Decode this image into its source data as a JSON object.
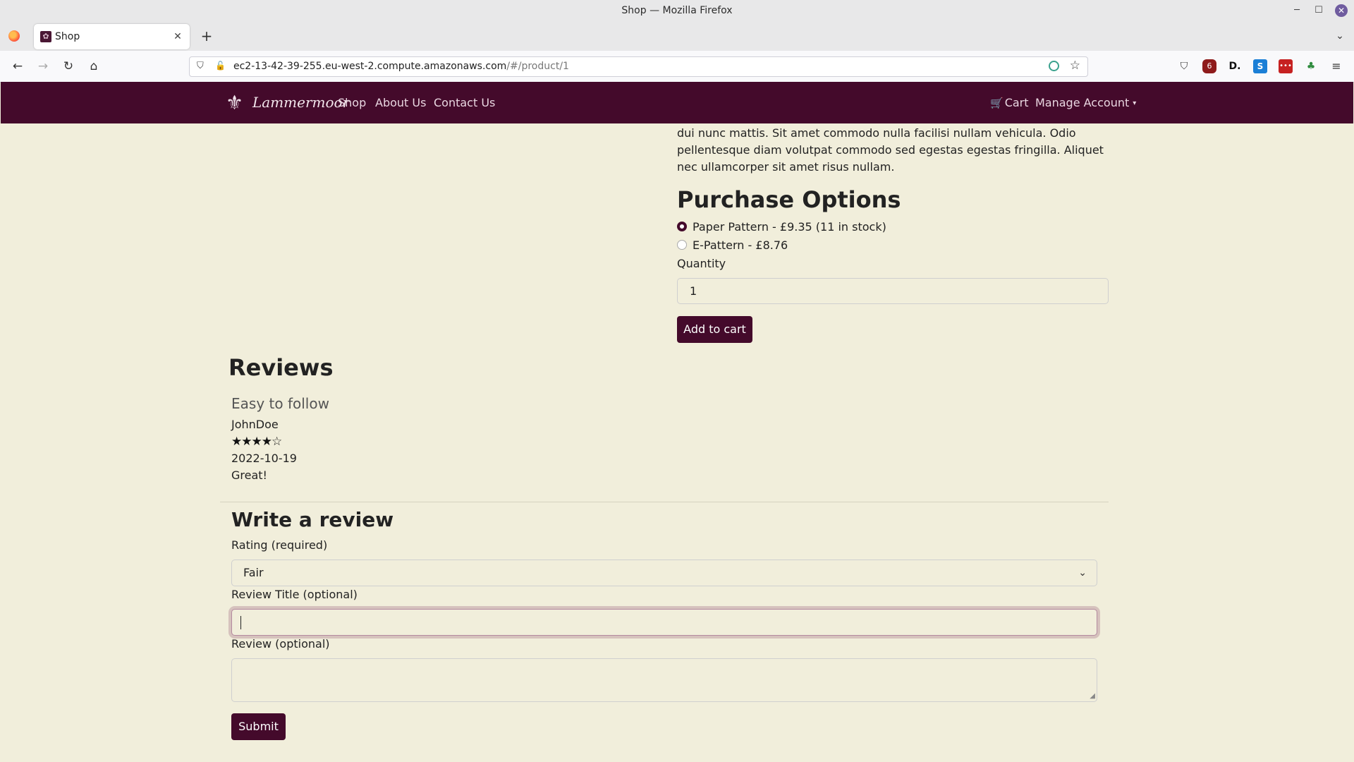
{
  "window": {
    "title": "Shop — Mozilla Firefox",
    "minimize_glyph": "─",
    "maximize_glyph": "☐",
    "close_glyph": "✕"
  },
  "tabbar": {
    "tab_title": "Shop",
    "favicon_glyph": "✿",
    "tab_close_glyph": "✕",
    "new_tab_glyph": "+",
    "tab_list_glyph": "⌄"
  },
  "toolbar": {
    "back_glyph": "←",
    "forward_glyph": "→",
    "reload_glyph": "↻",
    "home_glyph": "⌂"
  },
  "url": {
    "host": "ec2-13-42-39-255.eu-west-2.compute.amazonaws.com",
    "path": "/#/product/1",
    "shield_glyph": "⛉",
    "lock_glyph": "🔓",
    "star_glyph": "☆"
  },
  "extensions": {
    "pocket_glyph": "⛉",
    "ublock_glyph": "6",
    "d_glyph": "D.",
    "s_glyph": "S",
    "red_glyph": "•••",
    "green_glyph": "♣",
    "menu_glyph": "≡"
  },
  "site_nav": {
    "brand_mark": "⚜",
    "brand_name": "Lammermoor",
    "links": [
      "Shop",
      "About Us",
      "Contact Us"
    ],
    "cart_icon": "🛒",
    "cart_label": "Cart",
    "account_label": "Manage Account",
    "caret": "▾"
  },
  "product": {
    "description_tail": "dui nunc mattis. Sit amet commodo nulla facilisi nullam vehicula. Odio pellentesque diam volutpat commodo sed egestas egestas fringilla. Aliquet nec ullamcorper sit amet risus nullam.",
    "purchase_heading": "Purchase Options",
    "options": [
      {
        "label": "Paper Pattern - £9.35 (11 in stock)",
        "selected": true
      },
      {
        "label": "E-Pattern - £8.76",
        "selected": false
      }
    ],
    "quantity_label": "Quantity",
    "quantity_value": "1",
    "add_to_cart_label": "Add to cart"
  },
  "reviews": {
    "heading": "Reviews",
    "items": [
      {
        "title": "Easy to follow",
        "author": "JohnDoe",
        "rating": 4,
        "rating_max": 5,
        "stars_display": "★★★★☆",
        "date": "2022-10-19",
        "body": "Great!"
      }
    ]
  },
  "review_form": {
    "heading": "Write a review",
    "rating_label": "Rating (required)",
    "rating_value": "Fair",
    "chevron_glyph": "⌄",
    "title_label": "Review Title (optional)",
    "title_value": "",
    "body_label": "Review (optional)",
    "body_value": "",
    "resize_glyph": "◢",
    "submit_label": "Submit"
  },
  "colors": {
    "brand": "#440a2b",
    "page_background": "#f1eedb"
  }
}
